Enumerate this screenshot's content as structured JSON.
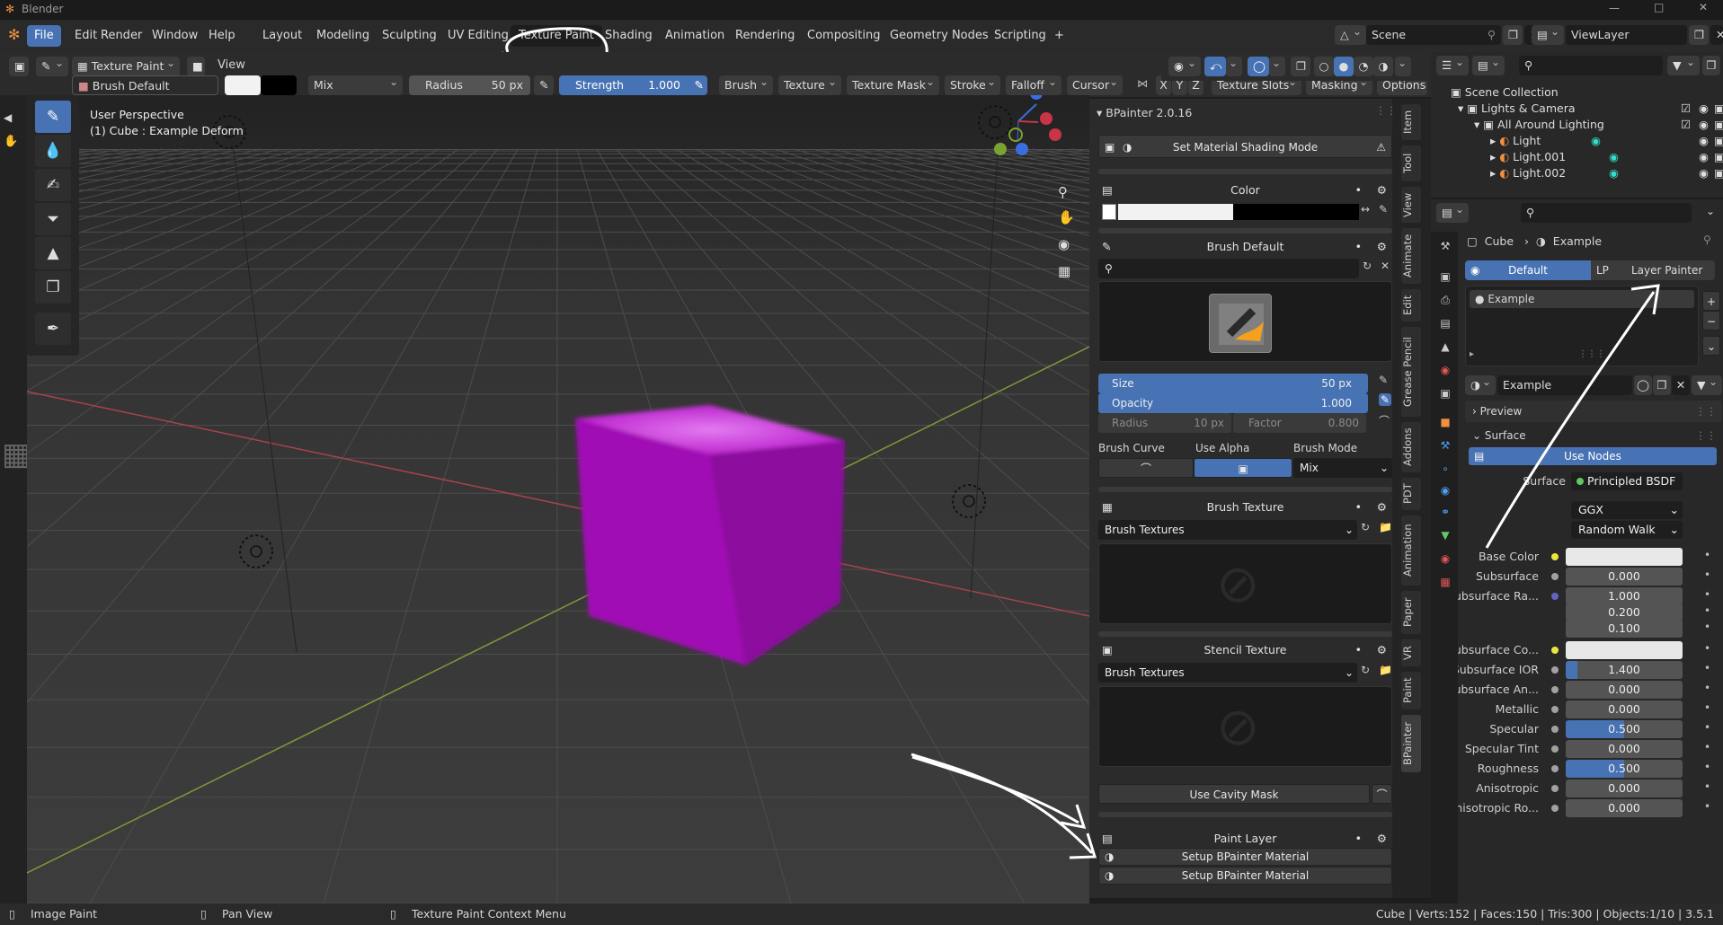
{
  "title_bar": {
    "app_name": "Blender"
  },
  "menu": {
    "items": [
      "File",
      "Edit",
      "Render",
      "Window",
      "Help"
    ]
  },
  "workspaces": [
    "Layout",
    "Modeling",
    "Sculpting",
    "UV Editing",
    "Texture Paint",
    "Shading",
    "Animation",
    "Rendering",
    "Compositing",
    "Geometry Nodes",
    "Scripting",
    "+"
  ],
  "scene": {
    "name": "Scene",
    "view_layer": "ViewLayer"
  },
  "editor_header": {
    "mode": "Texture Paint",
    "view_label": "View"
  },
  "tool_settings": {
    "brush": "Brush Default",
    "blend": "Mix",
    "radius_label": "Radius",
    "radius_value": "50 px",
    "strength_label": "Strength",
    "strength_value": "1.000",
    "menus": [
      "Brush",
      "Texture",
      "Texture Mask",
      "Stroke",
      "Falloff",
      "Cursor"
    ],
    "axes": [
      "X",
      "Y",
      "Z"
    ],
    "right_menus": [
      "Texture Slots",
      "Masking",
      "Options"
    ]
  },
  "viewport": {
    "perspective": "User Perspective",
    "object_info": "(1) Cube : Example Deform"
  },
  "bpainter": {
    "header": "BPainter 2.0.16",
    "shading_button": "Set Material Shading Mode",
    "color_panel": "Color",
    "brush_panel": "Brush Default",
    "size_label": "Size",
    "size_value": "50 px",
    "opacity_label": "Opacity",
    "opacity_value": "1.000",
    "radius_label": "Radius",
    "radius_value": "10 px",
    "factor_label": "Factor",
    "factor_value": "0.800",
    "brush_curve": "Brush Curve",
    "use_alpha": "Use Alpha",
    "brush_mode": "Brush Mode",
    "brush_mode_value": "Mix",
    "brush_texture_panel": "Brush Texture",
    "brush_textures": "Brush Textures",
    "stencil_panel": "Stencil Texture",
    "stencil_textures": "Brush Textures",
    "cavity_button": "Use Cavity Mask",
    "paint_layer_panel": "Paint Layer",
    "setup_button_1": "Setup BPainter Material",
    "setup_button_2": "Setup BPainter Material"
  },
  "sidebar_tabs": [
    "Item",
    "Tool",
    "View",
    "Animate",
    "Edit",
    "Grease Pencil",
    "Addons",
    "PDT",
    "Animation",
    "Paper",
    "VR",
    "Paint",
    "BPainter"
  ],
  "outliner": {
    "scene_collection": "Scene Collection",
    "collection": "Lights & Camera",
    "group": "All Around Lighting",
    "lights": [
      "Light",
      "Light.001",
      "Light.002"
    ]
  },
  "properties": {
    "breadcrumb_object": "Cube",
    "breadcrumb_material": "Example",
    "tab_default": "Default",
    "tab_lp": "LP",
    "tab_layer_painter": "Layer Painter",
    "slot_name": "Example",
    "material_name": "Example",
    "preview": "Preview",
    "surface": "Surface",
    "use_nodes": "Use Nodes",
    "surface_label": "Surface",
    "surface_shader": "Principled BSDF",
    "distribution": "GGX",
    "subsurface_method": "Random Walk",
    "rows": [
      {
        "label": "Base Color",
        "value": "",
        "type": "color-white",
        "fill": 0
      },
      {
        "label": "Subsurface",
        "value": "0.000",
        "type": "num",
        "fill": 0
      },
      {
        "label": "Subsurface Ra...",
        "value": "1.000",
        "type": "vec",
        "fill": 0
      },
      {
        "label": "",
        "value": "0.200",
        "type": "vec2",
        "fill": 0
      },
      {
        "label": "",
        "value": "0.100",
        "type": "vec3",
        "fill": 0
      },
      {
        "label": "Subsurface Co...",
        "value": "",
        "type": "color-white",
        "fill": 0
      },
      {
        "label": "Subsurface IOR",
        "value": "1.400",
        "type": "num",
        "fill": 0.1
      },
      {
        "label": "Subsurface An...",
        "value": "0.000",
        "type": "num",
        "fill": 0
      },
      {
        "label": "Metallic",
        "value": "0.000",
        "type": "num",
        "fill": 0
      },
      {
        "label": "Specular",
        "value": "0.500",
        "type": "num",
        "fill": 0.5
      },
      {
        "label": "Specular Tint",
        "value": "0.000",
        "type": "num",
        "fill": 0
      },
      {
        "label": "Roughness",
        "value": "0.500",
        "type": "num",
        "fill": 0.5
      },
      {
        "label": "Anisotropic",
        "value": "0.000",
        "type": "num",
        "fill": 0
      },
      {
        "label": "Anisotropic Ro...",
        "value": "0.000",
        "type": "num",
        "fill": 0
      }
    ]
  },
  "status_bar": {
    "left": "Image Paint",
    "middle": "Pan View",
    "context": "Texture Paint Context Menu",
    "stats": "Cube | Verts:152 | Faces:150 | Tris:300 | Objects:1/10 | 3.5.1"
  },
  "colors": {
    "accent": "#4772b3",
    "cube": "#b814c8",
    "x_axis": "#b33a44",
    "y_axis": "#7fa33a",
    "grid": "#505050",
    "background": "#3a3a3a"
  }
}
